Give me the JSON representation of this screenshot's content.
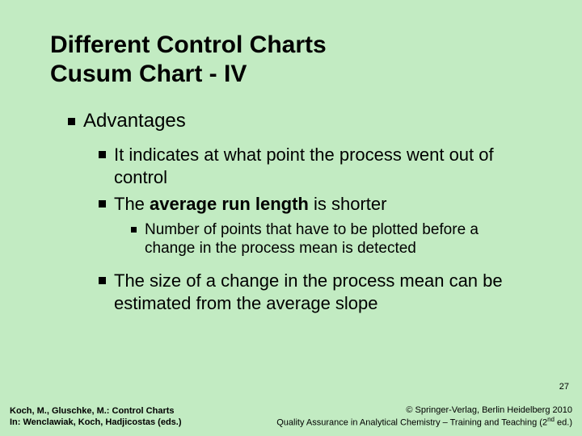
{
  "title_line1": "Different Control Charts",
  "title_line2": "Cusum Chart - IV",
  "advantages_label": "Advantages",
  "bullets": {
    "b1": "It indicates at what point the process went out of control",
    "b2_pre": "The ",
    "b2_bold": "average run length",
    "b2_post": " is shorter",
    "b2_sub": "Number of points that have to be plotted before a change in the process mean is detected",
    "b3": "The size of a change in the process mean can be estimated from the average slope"
  },
  "page_number": "27",
  "footer": {
    "authors": "Koch, M., Gluschke, M.: Control Charts",
    "in_line": "In: Wenclawiak, Koch, Hadjicostas (eds.)",
    "copyright": "© Springer-Verlag, Berlin Heidelberg 2010",
    "subtitle_pre": "Quality Assurance in Analytical Chemistry – Training and Teaching (2",
    "subtitle_sup": "nd",
    "subtitle_post": " ed.)"
  }
}
